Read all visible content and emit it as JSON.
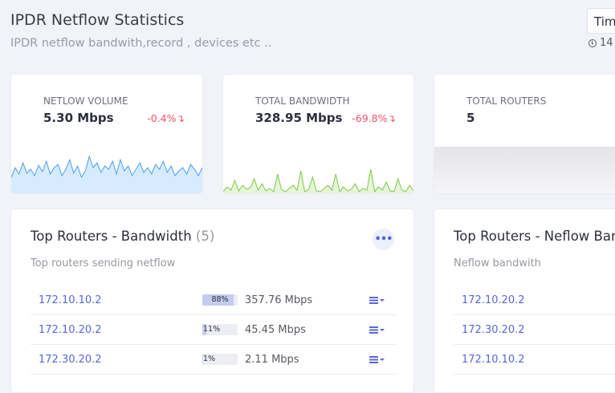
{
  "header": {
    "title": "IPDR Netflow Statistics",
    "subtitle": "IPDR netflow bandwith,record , devices etc ..",
    "time_button": "Tim",
    "time_text": "14"
  },
  "stats": [
    {
      "label": "NETLOW VOLUME",
      "value": "5.30 Mbps",
      "delta": "-0.4%↴"
    },
    {
      "label": "TOTAL BANDWIDTH",
      "value": "328.95 Mbps",
      "delta": "-69.8%↴"
    },
    {
      "label": "TOTAL ROUTERS",
      "value": "5"
    }
  ],
  "panels": {
    "bandwidth": {
      "title": "Top Routers - Bandwidth",
      "count": "(5)",
      "subtitle": "Top routers sending netflow",
      "more_icon": "•••",
      "rows": [
        {
          "ip": "172.10.10.2",
          "pct": "88%",
          "fill": 0.88,
          "bw": "357.76 Mbps"
        },
        {
          "ip": "172.10.20.2",
          "pct": "11%",
          "fill": 0.11,
          "bw": "45.45 Mbps"
        },
        {
          "ip": "172.30.20.2",
          "pct": "1%",
          "fill": 0.01,
          "bw": "2.11 Mbps"
        }
      ]
    },
    "netflow": {
      "title": "Top Routers - Neflow Ban",
      "subtitle": "Neflow bandwith",
      "rows": [
        {
          "ip": "172.10.20.2"
        },
        {
          "ip": "172.30.20.2"
        },
        {
          "ip": "172.10.10.2"
        }
      ]
    }
  },
  "colors": {
    "accent": "#5867dd",
    "danger": "#f4516c",
    "spark_blue": "#4a9ff5",
    "spark_green": "#7bc94a"
  }
}
